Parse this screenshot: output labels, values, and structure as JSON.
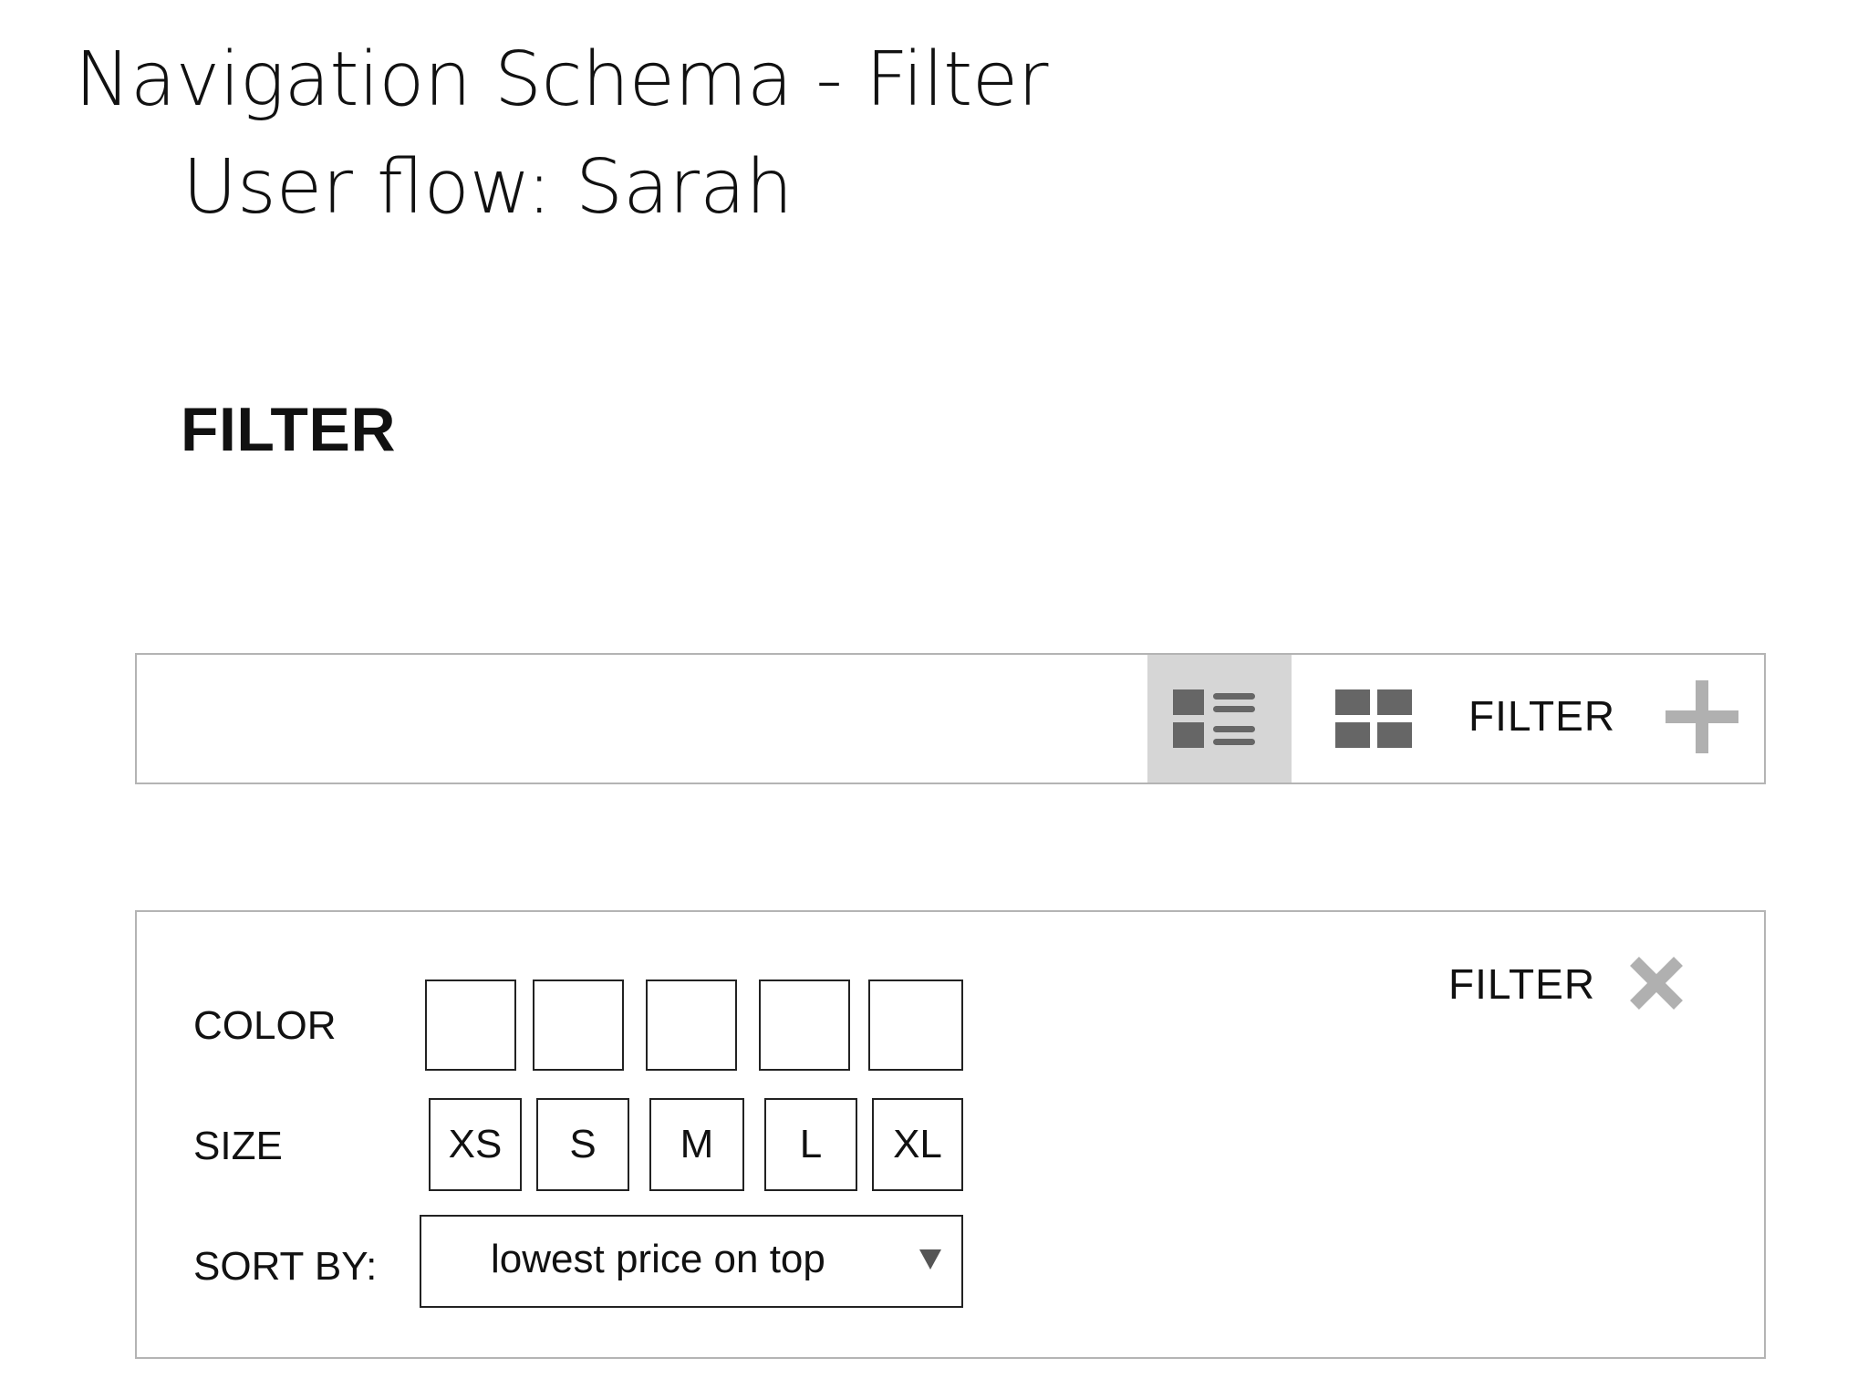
{
  "header": {
    "title": "Navigation Schema - Filter",
    "subtitle": "User flow: Sarah"
  },
  "section": {
    "heading": "FILTER"
  },
  "toolbar": {
    "list_view_icon": "list-view-icon",
    "grid_view_icon": "grid-view-icon",
    "filter_label": "FILTER",
    "expand_icon": "plus-icon"
  },
  "filter_panel": {
    "filter_label": "FILTER",
    "close_icon": "close-icon",
    "color": {
      "label": "COLOR",
      "swatch_count": 5
    },
    "size": {
      "label": "SIZE",
      "options": [
        "XS",
        "S",
        "M",
        "L",
        "XL"
      ]
    },
    "sort": {
      "label": "SORT BY:",
      "selected": "lowest price on top"
    }
  },
  "colors": {
    "border": "#b4b4b4",
    "active_view_bg": "#d6d6d6",
    "icon_dark": "#666666",
    "icon_light": "#b0b0b0"
  }
}
